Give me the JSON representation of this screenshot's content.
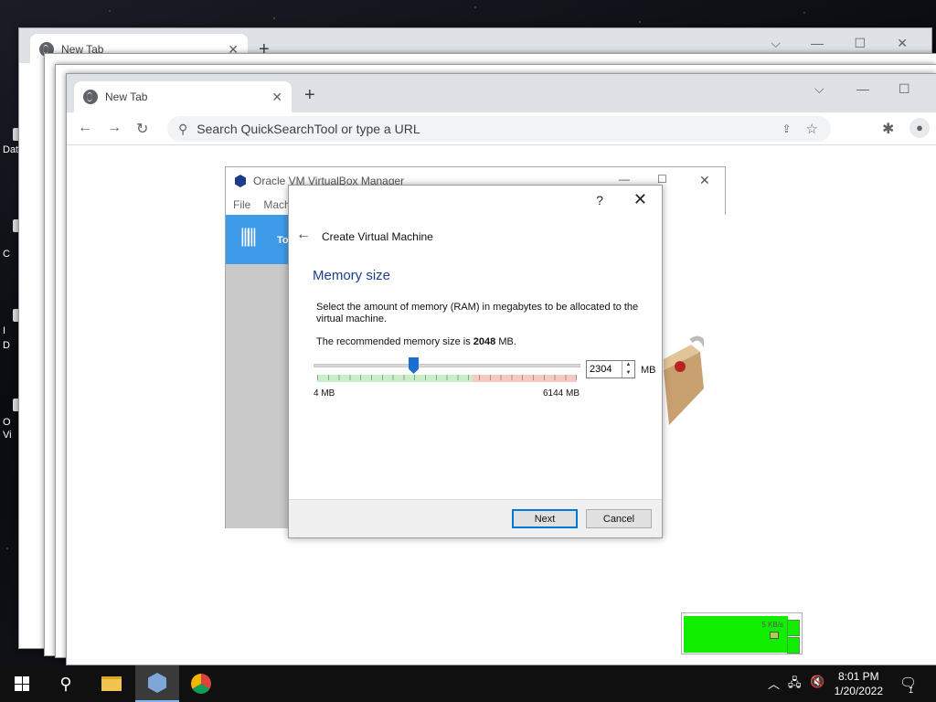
{
  "desktop": {
    "labels": [
      "Dat",
      "C",
      "I",
      "D",
      "O",
      "Vi"
    ]
  },
  "browser_back": {
    "tab_title": "New Tab"
  },
  "browser": {
    "tab_title": "New Tab",
    "omnibox_placeholder": "Search QuickSearchTool or type a URL"
  },
  "vbox_manager": {
    "title": "Oracle VM VirtualBox Manager",
    "menu": [
      "File",
      "Mach"
    ],
    "tools_label": "To"
  },
  "dialog": {
    "help": "?",
    "title": "Create Virtual Machine",
    "section_title": "Memory size",
    "description": "Select the amount of memory (RAM) in megabytes to be allocated to the virtual machine.",
    "recommend_prefix": "The recommended memory size is",
    "recommend_value": "2048",
    "recommend_suffix": "MB.",
    "memory_value": "2304",
    "memory_unit": "MB",
    "slider_fraction": 0.375,
    "min_label": "4 MB",
    "max_label": "6144 MB",
    "next_label": "Next",
    "cancel_label": "Cancel"
  },
  "net_widget": {
    "rate": "5 KB/s"
  },
  "taskbar": {
    "time": "8:01 PM",
    "date": "1/20/2022",
    "notification_count": "1"
  },
  "colors": {
    "accent_blue": "#1a6fd0",
    "vbox_tools_blue": "#3e9be9",
    "net_green": "#12ee00"
  }
}
